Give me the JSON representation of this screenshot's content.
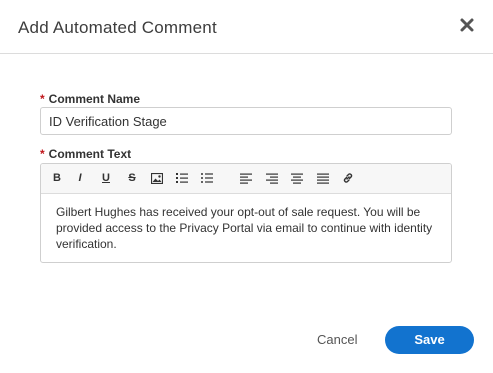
{
  "dialog": {
    "title": "Add Automated Comment",
    "close_icon": "close-icon"
  },
  "form": {
    "comment_name": {
      "required_mark": "*",
      "label": "Comment Name",
      "value": "ID Verification Stage"
    },
    "comment_text": {
      "required_mark": "*",
      "label": "Comment Text",
      "value": "Gilbert Hughes has received your opt-out of sale request. You will be provided access to the Privacy Portal via email to continue with identity verification."
    }
  },
  "toolbar": {
    "buttons": [
      {
        "name": "bold",
        "glyph": "B"
      },
      {
        "name": "italic",
        "glyph": "I"
      },
      {
        "name": "underline",
        "glyph": "U"
      },
      {
        "name": "strikethrough",
        "glyph": "S"
      },
      {
        "name": "image",
        "icon": "image-icon"
      },
      {
        "name": "ordered-list",
        "icon": "ordered-list-icon"
      },
      {
        "name": "unordered-list",
        "icon": "unordered-list-icon"
      },
      {
        "name": "align-left",
        "icon": "align-left-icon"
      },
      {
        "name": "align-right",
        "icon": "align-right-icon"
      },
      {
        "name": "align-center",
        "icon": "align-center-icon"
      },
      {
        "name": "align-justify",
        "icon": "align-justify-icon"
      },
      {
        "name": "link",
        "icon": "link-icon"
      }
    ]
  },
  "footer": {
    "cancel_label": "Cancel",
    "save_label": "Save"
  },
  "colors": {
    "primary": "#1273cf",
    "required": "#c0161b"
  }
}
